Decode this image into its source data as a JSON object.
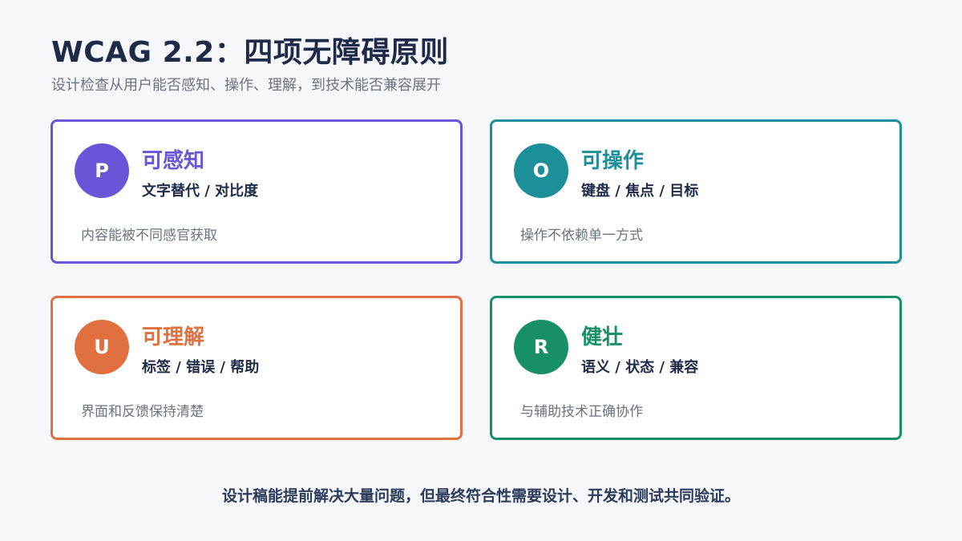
{
  "header": {
    "title": "WCAG 2.2：四项无障碍原则",
    "subtitle": "设计检查从用户能否感知、操作、理解，到技术能否兼容展开"
  },
  "cards": [
    {
      "letter": "P",
      "title": "可感知",
      "subtitle": "文字替代 / 对比度",
      "desc": "内容能被不同感官获取",
      "color": "#6a55d8"
    },
    {
      "letter": "O",
      "title": "可操作",
      "subtitle": "键盘 / 焦点 / 目标",
      "desc": "操作不依赖单一方式",
      "color": "#1c8f99"
    },
    {
      "letter": "U",
      "title": "可理解",
      "subtitle": "标签 / 错误 / 帮助",
      "desc": "界面和反馈保持清楚",
      "color": "#e07040"
    },
    {
      "letter": "R",
      "title": "健壮",
      "subtitle": "语义 / 状态 / 兼容",
      "desc": "与辅助技术正确协作",
      "color": "#179066"
    }
  ],
  "footer": {
    "note": "设计稿能提前解决大量问题，但最终符合性需要设计、开发和测试共同验证。"
  }
}
